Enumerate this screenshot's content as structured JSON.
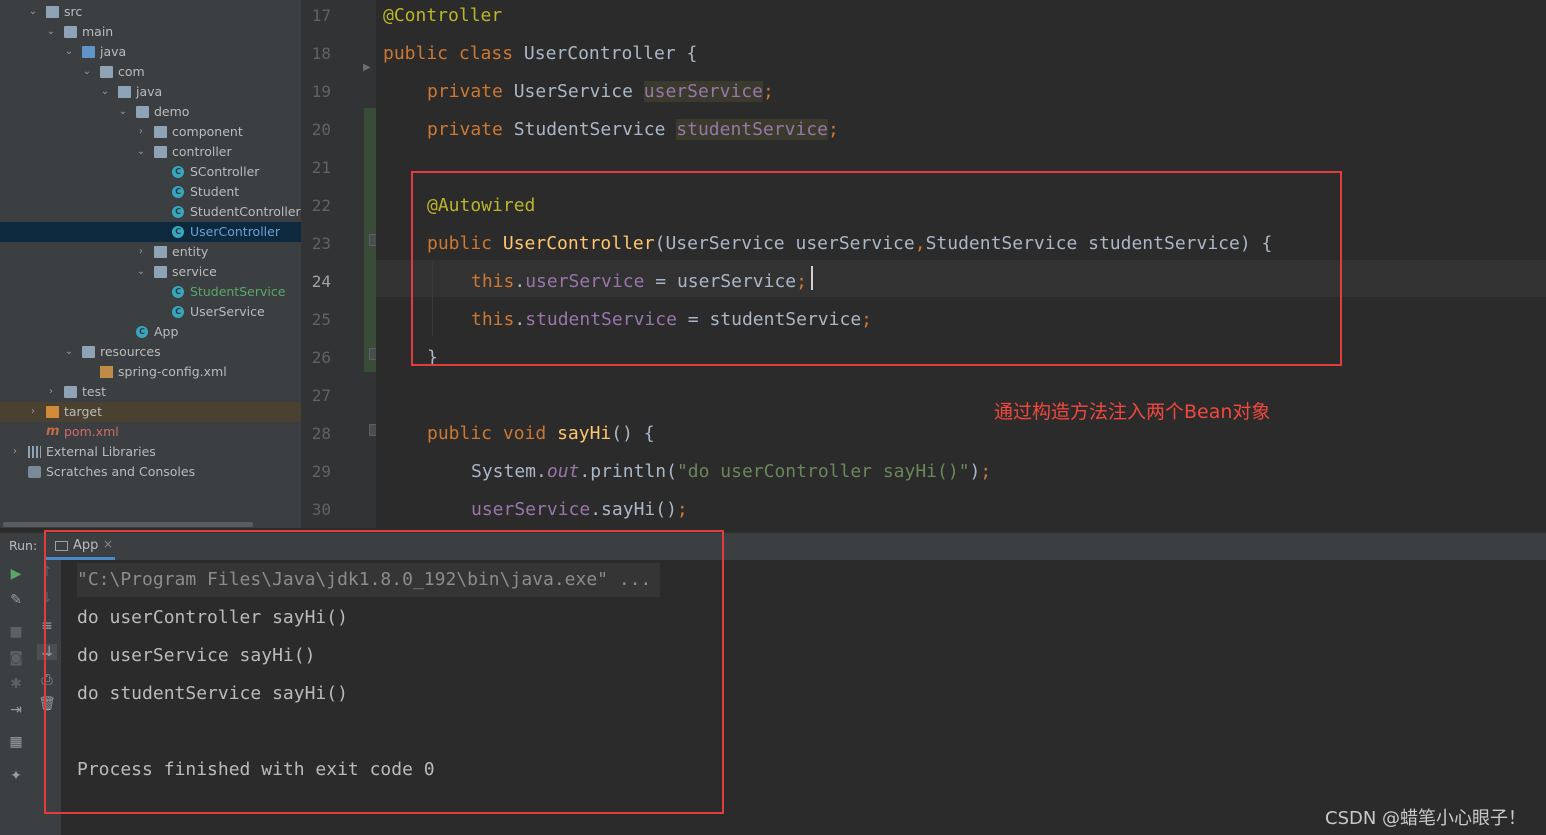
{
  "project_tree": {
    "items": [
      {
        "label": "src",
        "indent": 0
      },
      {
        "label": "main",
        "indent": 1
      },
      {
        "label": "java",
        "indent": 2
      },
      {
        "label": "com",
        "indent": 3
      },
      {
        "label": "java",
        "indent": 4
      },
      {
        "label": "demo",
        "indent": 5
      },
      {
        "label": "component",
        "indent": 6
      },
      {
        "label": "controller",
        "indent": 6
      },
      {
        "label": "SController",
        "indent": 7
      },
      {
        "label": "Student",
        "indent": 7
      },
      {
        "label": "StudentController",
        "indent": 7
      },
      {
        "label": "UserController",
        "indent": 7
      },
      {
        "label": "entity",
        "indent": 6
      },
      {
        "label": "service",
        "indent": 6
      },
      {
        "label": "StudentService",
        "indent": 7
      },
      {
        "label": "UserService",
        "indent": 7
      },
      {
        "label": "App",
        "indent": 5
      },
      {
        "label": "resources",
        "indent": 2
      },
      {
        "label": "spring-config.xml",
        "indent": 3
      },
      {
        "label": "test",
        "indent": 1
      },
      {
        "label": "target",
        "indent": 0
      },
      {
        "label": "pom.xml",
        "indent": 0
      },
      {
        "label": "External Libraries",
        "indent": 0
      },
      {
        "label": "Scratches and Consoles",
        "indent": 0
      }
    ],
    "selected": "UserController",
    "class_icon_letter": "C",
    "maven_icon_letter": "m"
  },
  "editor": {
    "line_numbers": [
      "17",
      "18",
      "19",
      "20",
      "21",
      "22",
      "23",
      "24",
      "25",
      "26",
      "27",
      "28",
      "29",
      "30"
    ],
    "current_line": "24",
    "code": {
      "l17": {
        "annotation": "@Controller"
      },
      "l18": {
        "kw1": "public",
        "kw2": "class",
        "name": "UserController",
        "brace": "{"
      },
      "l19": {
        "kw": "private",
        "type": "UserService",
        "field": "userService",
        "semi": ";"
      },
      "l20": {
        "kw": "private",
        "type": "StudentService",
        "field": "studentService",
        "semi": ";"
      },
      "l22": {
        "annotation": "@Autowired"
      },
      "l23": {
        "kw": "public",
        "name": "UserController",
        "open": "(",
        "p1type": "UserService",
        "p1name": "userService",
        "comma": ",",
        "p2type": "StudentService",
        "p2name": "studentService",
        "close": ") {"
      },
      "l24": {
        "this": "this",
        "dot": ".",
        "field": "userService",
        "eq": " = ",
        "value": "userService",
        "semi": ";"
      },
      "l25": {
        "this": "this",
        "dot": ".",
        "field": "studentService",
        "eq": " = ",
        "value": "studentService",
        "semi": ";"
      },
      "l26": {
        "brace": "}"
      },
      "l28": {
        "kw1": "public",
        "kw2": "void",
        "name": "sayHi",
        "rest": "() {"
      },
      "l29": {
        "cls": "System",
        "dot": ".",
        "out": "out",
        "method": ".println(",
        "str": "\"do userController sayHi()\"",
        "end": ")",
        "semi": ";"
      },
      "l30": {
        "field": "userService",
        "call": ".sayHi()",
        "semi": ";"
      }
    },
    "annotation_note": "通过构造方法注入两个Bean对象"
  },
  "run_panel": {
    "label": "Run:",
    "tab_label": "App",
    "tab_close": "×",
    "console_lines": [
      "\"C:\\Program Files\\Java\\jdk1.8.0_192\\bin\\java.exe\" ...",
      "do userController sayHi()",
      "do userService sayHi()",
      "do studentService sayHi()",
      "",
      "Process finished with exit code 0"
    ],
    "toolbar_icons": [
      "run-icon",
      "wrench-icon",
      "stop-icon",
      "camera-icon",
      "debug-icon",
      "exit-icon",
      "layout-icon",
      "pin-icon"
    ],
    "toolbar2_icons": [
      "up-arrow-icon",
      "down-arrow-icon",
      "soft-wrap-icon",
      "scroll-to-end-icon",
      "print-icon",
      "trash-icon"
    ]
  },
  "watermark": "CSDN @蜡笔小心眼子！",
  "colors": {
    "keyword": "#cc7832",
    "annotation": "#bbb529",
    "function": "#ffc66d",
    "field": "#9876aa",
    "string": "#6a8759",
    "highlight_box": "#e23c3c"
  }
}
